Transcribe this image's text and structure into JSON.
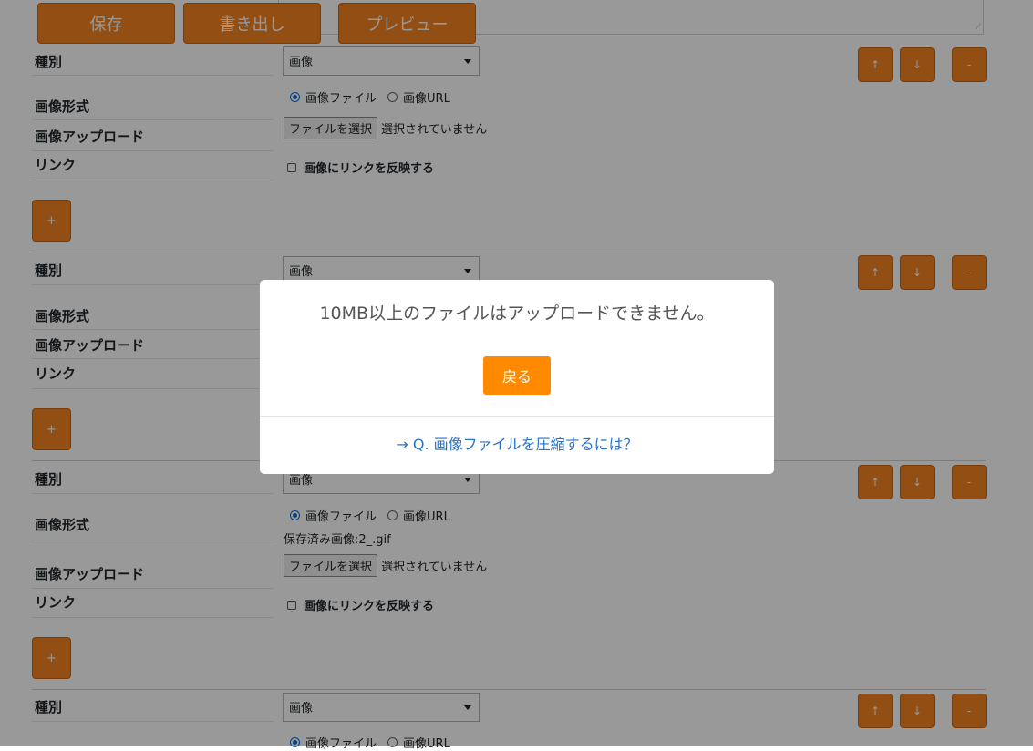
{
  "toolbar": {
    "save_label": "保存",
    "export_label": "書き出し",
    "preview_label": "プレビュー"
  },
  "labels": {
    "type": "種別",
    "image_format": "画像形式",
    "image_upload": "画像アップロード",
    "link": "リンク"
  },
  "form": {
    "type_value": "画像",
    "radio_file": "画像ファイル",
    "radio_url": "画像URL",
    "file_button": "ファイルを選択",
    "no_file": "選択されていません",
    "link_checkbox": "画像にリンクを反映する",
    "saved_image": "保存済み画像:2_.gif"
  },
  "controls": {
    "up": "↑",
    "down": "↓",
    "remove": "-",
    "add": "+"
  },
  "modal": {
    "message": "10MB以上のファイルはアップロードできません。",
    "back_label": "戻る",
    "help_link": "→ Q. 画像ファイルを圧縮するには？"
  },
  "colors": {
    "accent": "#f58220",
    "modal_button": "#ff8a00",
    "link": "#2a72c9",
    "radio_selected": "#0b6bd6"
  }
}
